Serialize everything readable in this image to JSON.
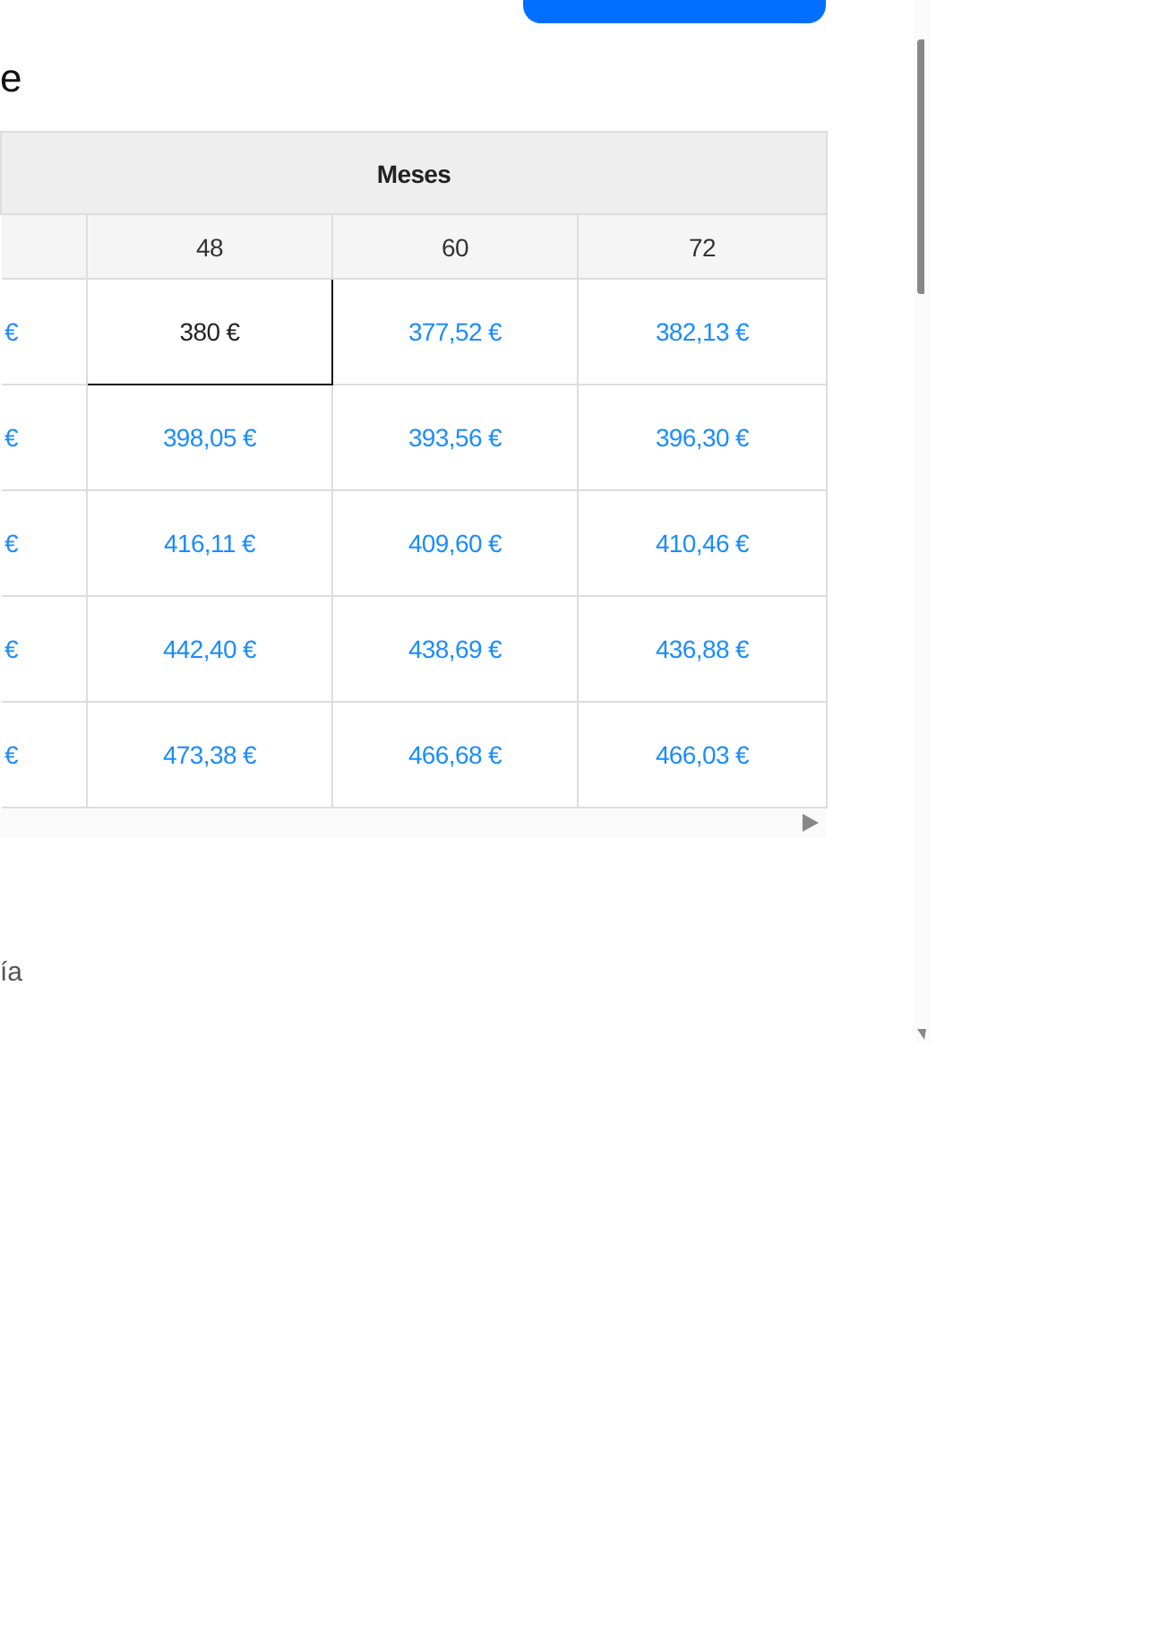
{
  "heading": "e",
  "table": {
    "group_header": "Meses",
    "columns": [
      "",
      "48",
      "60",
      "72"
    ],
    "rows": [
      {
        "cells": [
          {
            "text": "€",
            "selected": false
          },
          {
            "text": "380 €",
            "selected": true
          },
          {
            "text": "377,52 €",
            "selected": false
          },
          {
            "text": "382,13 €",
            "selected": false
          }
        ]
      },
      {
        "cells": [
          {
            "text": "€",
            "selected": false
          },
          {
            "text": "398,05 €",
            "selected": false
          },
          {
            "text": "393,56 €",
            "selected": false
          },
          {
            "text": "396,30 €",
            "selected": false
          }
        ]
      },
      {
        "cells": [
          {
            "text": "€",
            "selected": false
          },
          {
            "text": "416,11 €",
            "selected": false
          },
          {
            "text": "409,60 €",
            "selected": false
          },
          {
            "text": "410,46 €",
            "selected": false
          }
        ]
      },
      {
        "cells": [
          {
            "text": "€",
            "selected": false
          },
          {
            "text": "442,40 €",
            "selected": false
          },
          {
            "text": "438,69 €",
            "selected": false
          },
          {
            "text": "436,88 €",
            "selected": false
          }
        ]
      },
      {
        "cells": [
          {
            "text": "€",
            "selected": false
          },
          {
            "text": "473,38 €",
            "selected": false
          },
          {
            "text": "466,68 €",
            "selected": false
          },
          {
            "text": "466,03 €",
            "selected": false
          }
        ]
      }
    ]
  },
  "footnote": "ía"
}
